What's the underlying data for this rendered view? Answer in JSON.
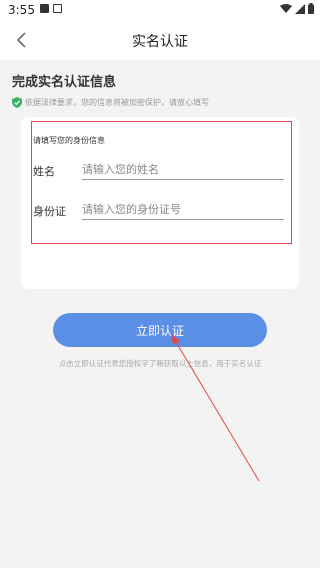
{
  "status_bar": {
    "time": "3:55",
    "icons": [
      "image-icon",
      "notification-a-icon",
      "wifi-icon",
      "signal-icon",
      "battery-icon"
    ]
  },
  "nav": {
    "title": "实名认证",
    "back_icon": "chevron-left-icon"
  },
  "section": {
    "title": "完成实名认证信息",
    "privacy_note": "依据法律要求，您的信息将被加密保护，请放心填写",
    "privacy_icon": "shield-check-icon"
  },
  "form": {
    "hint": "请填写您的身份信息",
    "name_label": "姓名",
    "name_placeholder": "请输入您的姓名",
    "name_value": "",
    "id_label": "身份证",
    "id_placeholder": "请输入您的身份证号",
    "id_value": ""
  },
  "actions": {
    "submit_label": "立即认证",
    "agreement_text": "点击立即认证代表您授权字了嘛获取以上信息，用于实名认证"
  },
  "colors": {
    "primary_button": "#5b8fe6",
    "annotation_red": "#e04848",
    "shield_green": "#3bb46a",
    "background": "#f3f3f3"
  }
}
